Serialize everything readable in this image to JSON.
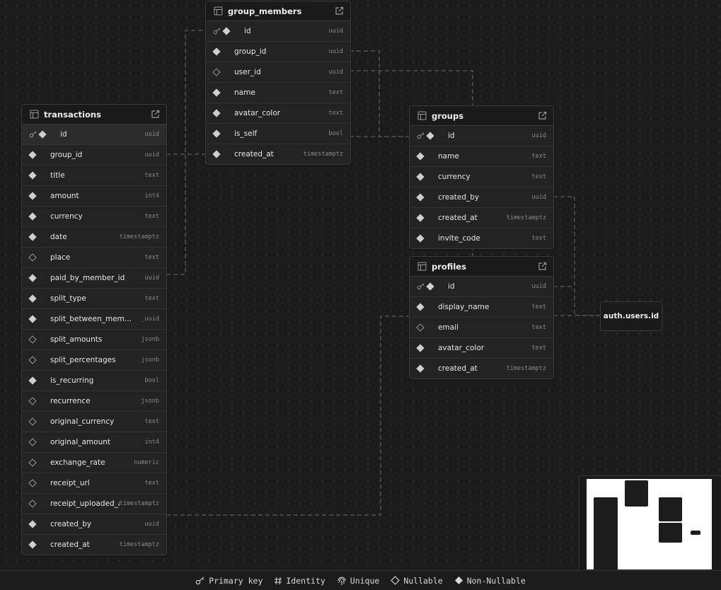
{
  "tables": {
    "transactions": {
      "name": "transactions",
      "columns": [
        {
          "name": "id",
          "type": "uuid",
          "pk": true,
          "nullable": false
        },
        {
          "name": "group_id",
          "type": "uuid",
          "pk": false,
          "nullable": false
        },
        {
          "name": "title",
          "type": "text",
          "pk": false,
          "nullable": false
        },
        {
          "name": "amount",
          "type": "int4",
          "pk": false,
          "nullable": false
        },
        {
          "name": "currency",
          "type": "text",
          "pk": false,
          "nullable": false
        },
        {
          "name": "date",
          "type": "timestamptz",
          "pk": false,
          "nullable": false
        },
        {
          "name": "place",
          "type": "text",
          "pk": false,
          "nullable": true
        },
        {
          "name": "paid_by_member_id",
          "type": "uuid",
          "pk": false,
          "nullable": false
        },
        {
          "name": "split_type",
          "type": "text",
          "pk": false,
          "nullable": false
        },
        {
          "name": "split_between_mem...",
          "type": "_uuid",
          "pk": false,
          "nullable": false
        },
        {
          "name": "split_amounts",
          "type": "jsonb",
          "pk": false,
          "nullable": true
        },
        {
          "name": "split_percentages",
          "type": "jsonb",
          "pk": false,
          "nullable": true
        },
        {
          "name": "is_recurring",
          "type": "bool",
          "pk": false,
          "nullable": false
        },
        {
          "name": "recurrence",
          "type": "jsonb",
          "pk": false,
          "nullable": true
        },
        {
          "name": "original_currency",
          "type": "text",
          "pk": false,
          "nullable": true
        },
        {
          "name": "original_amount",
          "type": "int4",
          "pk": false,
          "nullable": true
        },
        {
          "name": "exchange_rate",
          "type": "numeric",
          "pk": false,
          "nullable": true
        },
        {
          "name": "receipt_url",
          "type": "text",
          "pk": false,
          "nullable": true
        },
        {
          "name": "receipt_uploaded_at",
          "type": "timestamptz",
          "pk": false,
          "nullable": true
        },
        {
          "name": "created_by",
          "type": "uuid",
          "pk": false,
          "nullable": false
        },
        {
          "name": "created_at",
          "type": "timestamptz",
          "pk": false,
          "nullable": false
        }
      ]
    },
    "group_members": {
      "name": "group_members",
      "columns": [
        {
          "name": "id",
          "type": "uuid",
          "pk": true,
          "nullable": false
        },
        {
          "name": "group_id",
          "type": "uuid",
          "pk": false,
          "nullable": false
        },
        {
          "name": "user_id",
          "type": "uuid",
          "pk": false,
          "nullable": true
        },
        {
          "name": "name",
          "type": "text",
          "pk": false,
          "nullable": false
        },
        {
          "name": "avatar_color",
          "type": "text",
          "pk": false,
          "nullable": false
        },
        {
          "name": "is_self",
          "type": "bool",
          "pk": false,
          "nullable": false
        },
        {
          "name": "created_at",
          "type": "timestamptz",
          "pk": false,
          "nullable": false
        }
      ]
    },
    "groups": {
      "name": "groups",
      "columns": [
        {
          "name": "id",
          "type": "uuid",
          "pk": true,
          "nullable": false
        },
        {
          "name": "name",
          "type": "text",
          "pk": false,
          "nullable": false
        },
        {
          "name": "currency",
          "type": "text",
          "pk": false,
          "nullable": false
        },
        {
          "name": "created_by",
          "type": "uuid",
          "pk": false,
          "nullable": false
        },
        {
          "name": "created_at",
          "type": "timestamptz",
          "pk": false,
          "nullable": false
        },
        {
          "name": "invite_code",
          "type": "text",
          "pk": false,
          "nullable": false
        }
      ]
    },
    "profiles": {
      "name": "profiles",
      "columns": [
        {
          "name": "id",
          "type": "uuid",
          "pk": true,
          "nullable": false
        },
        {
          "name": "display_name",
          "type": "text",
          "pk": false,
          "nullable": false
        },
        {
          "name": "email",
          "type": "text",
          "pk": false,
          "nullable": true
        },
        {
          "name": "avatar_color",
          "type": "text",
          "pk": false,
          "nullable": false
        },
        {
          "name": "created_at",
          "type": "timestamptz",
          "pk": false,
          "nullable": false
        }
      ]
    }
  },
  "auth_node": "auth.users.id",
  "legend": {
    "primary_key": "Primary key",
    "identity": "Identity",
    "unique": "Unique",
    "nullable": "Nullable",
    "non_nullable": "Non-Nullable"
  },
  "colors": {
    "canvas": "#1c1c1c",
    "table_bg": "#232323",
    "header_bg": "#1a1a1a",
    "border": "#3a3a3a",
    "relation_line": "#6b6b6b",
    "type_text": "#8a8a8a"
  },
  "icons": {
    "table": "table-grid-icon",
    "open": "external-link-icon",
    "primary_key": "key-icon",
    "non_nullable": "filled-diamond-icon",
    "nullable": "hollow-diamond-icon",
    "identity": "hash-icon",
    "unique": "fingerprint-icon"
  }
}
